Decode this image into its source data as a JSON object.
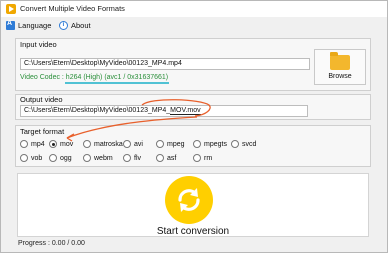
{
  "window": {
    "title": "Convert Multiple Video Formats",
    "icon": "app-play-icon"
  },
  "menu": [
    {
      "label": "Language",
      "icon": "language-icon"
    },
    {
      "label": "About",
      "icon": "info-icon"
    }
  ],
  "input_video": {
    "label": "Input video",
    "path": "C:\\Users\\Etern\\Desktop\\MyVideo\\00123_MP4.mp4",
    "codec_prefix": "Video Codec : ",
    "codec_value": "h264 (High) (avc1 / 0x31637661)",
    "browse_label": "Browse"
  },
  "output_video": {
    "label": "Output video",
    "path_prefix": "C:\\Users\\Etern\\Desktop\\MyVideo\\00123_MP4_",
    "path_highlight": "MOV.mov"
  },
  "target_format": {
    "label": "Target format",
    "selected": "mov",
    "options_row1": [
      "mp4",
      "mov",
      "matroska",
      "avi",
      "mpeg",
      "mpegts",
      "svcd"
    ],
    "options_row2": [
      "vob",
      "ogg",
      "webm",
      "flv",
      "asf",
      "rm"
    ]
  },
  "convert": {
    "label": "Start conversion",
    "icon": "convert-arrows-icon",
    "accent": "#ffcf00"
  },
  "progress": {
    "text": "Progress : 0.00 / 0.00"
  },
  "colors": {
    "codec_text": "#2a8f3a",
    "codec_underline": "#1ab0c8",
    "annotation": "#e8602c"
  }
}
